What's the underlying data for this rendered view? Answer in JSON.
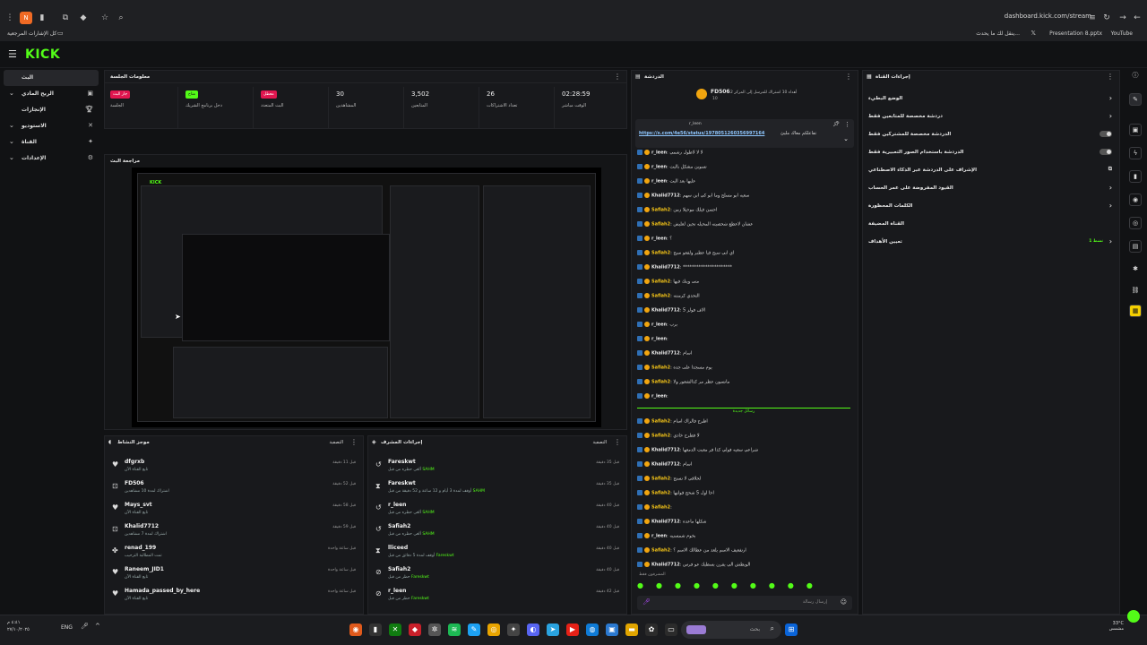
{
  "browser": {
    "url": "dashboard.kick.com/stream",
    "bookmarks_label": "كل الإشارات المرجعية",
    "bookmarks": [
      "ينقل لك ما يحدث...",
      "Presentation 8.pptx",
      "YouTube"
    ]
  },
  "app": {
    "logo": "KICK",
    "nav": [
      {
        "label": "البث",
        "icon": "broadcast-icon",
        "active": true
      },
      {
        "label": "الربح المادي",
        "icon": "money-icon"
      },
      {
        "label": "الإنجازات",
        "icon": "trophy-icon"
      },
      {
        "label": "الاستوديو",
        "icon": "studio-icon"
      },
      {
        "label": "القناة",
        "icon": "channel-icon"
      },
      {
        "label": "الإعدادات",
        "icon": "gear-icon"
      }
    ]
  },
  "session": {
    "title": "معلومات الجلسة",
    "stats": [
      {
        "badge": "جار البث",
        "badge_color": "#e0164f",
        "label": "الجلسة"
      },
      {
        "badge": "متاح",
        "badge_color": "#53fc18",
        "label": "دخل برنامج الشريك"
      },
      {
        "badge": "معطل",
        "badge_color": "#e0164f",
        "label": "البث المتعدد"
      },
      {
        "value": "30",
        "label": "المشاهدين"
      },
      {
        "value": "3,502",
        "label": "المتابعين"
      },
      {
        "value": "26",
        "label": "تعداد الاشتراكات"
      },
      {
        "value": "02:28:59",
        "label": "الوقت مباشر"
      }
    ]
  },
  "preview": {
    "title": "مراجعة البث"
  },
  "activity": {
    "title": "موجز النشاط",
    "filter_label": "التصفية",
    "items": [
      {
        "name": "dfgrxb",
        "sub": "تابع القناة الآن",
        "time": "قبل 11 دقيقة",
        "icon": "heart-icon"
      },
      {
        "name": "FD506",
        "sub": "اشتراك لمدة 10 مشاهدين",
        "time": "قبل 52 دقيقة",
        "icon": "gift-icon"
      },
      {
        "name": "Mays_svt",
        "sub": "تابع القناة الآن",
        "time": "قبل 58 دقيقة",
        "icon": "heart-icon"
      },
      {
        "name": "Khalid7712",
        "sub": "اشتراك لمدة 7 مشاهدين",
        "time": "قبل 59 دقيقة",
        "icon": "gift-icon"
      },
      {
        "name": "renad_199",
        "sub": "تمت المطالبة الترحيب",
        "time": "قبل ساعة واحدة",
        "icon": "reward-icon"
      },
      {
        "name": "Raneem_JID1",
        "sub": "تابع القناة الآن",
        "time": "قبل ساعة واحدة",
        "icon": "heart-icon"
      },
      {
        "name": "Hamada_passed_by_here",
        "sub": "تابع القناة الآن",
        "time": "قبل ساعة واحدة",
        "icon": "heart-icon"
      }
    ]
  },
  "modlog": {
    "title": "إجراءات المشرف",
    "filter_label": "التصفية",
    "items": [
      {
        "name": "Fareskwt",
        "sub": "ألغى حظره من قبل",
        "by": "SAHM",
        "time": "قبل 35 دقيقة",
        "icon": "undo-icon"
      },
      {
        "name": "Fareskwt",
        "sub": "أوقف لمدة 3 أيام و 12 ساعة و 52 دقيقة من قبل",
        "by": "SAHM",
        "time": "قبل 35 دقيقة",
        "icon": "hourglass-icon"
      },
      {
        "name": "r_leen",
        "sub": "ألغى حظره من قبل",
        "by": "SAHM",
        "time": "قبل 40 دقيقة",
        "icon": "undo-icon"
      },
      {
        "name": "Safiah2",
        "sub": "ألغى حظره من قبل",
        "by": "SAHM",
        "time": "قبل 40 دقيقة",
        "icon": "undo-icon"
      },
      {
        "name": "lliceed",
        "sub": "أوقف لمدة 5 دقائق من قبل",
        "by": "Fareskwt",
        "time": "قبل 40 دقيقة",
        "icon": "hourglass-icon"
      },
      {
        "name": "Safiah2",
        "sub": "حظر من قبل",
        "by": "Fareskwt",
        "time": "قبل 40 دقيقة",
        "icon": "ban-icon"
      },
      {
        "name": "r_leen",
        "sub": "حظر من قبل",
        "by": "Fareskwt",
        "time": "قبل 42 دقيقة",
        "icon": "ban-icon"
      }
    ]
  },
  "chat": {
    "title": "الدردشة",
    "pinned_user": "FD506",
    "pinned_sub": "أهداء 10 اشتراك للمرسل إلى المركز 2",
    "pinned_count": "10",
    "pinned_by": "r_leen",
    "pinned_link": "https://x.com/4e56/status/1978051260356997164",
    "pinned_text": "تفاعلكم معاك مليئ",
    "new_messages": "رسائل جديدة",
    "moderators_label": "المشرفون فقط",
    "input_placeholder": "إرسال رسالة",
    "messages": [
      {
        "user": "r_leen",
        "text": "لا لا لاطول رشمي",
        "yellow": false
      },
      {
        "user": "r_leen",
        "text": "تسوين مشكل بالبث",
        "yellow": false
      },
      {
        "user": "r_leen",
        "text": "عليها بعد البث",
        "yellow": false
      },
      {
        "user": "Khalid7712",
        "text": "سعيه ابو مسلح وما ابو كي ابن سهم",
        "yellow": false
      },
      {
        "user": "Safiah2",
        "text": "احسن قيلك موحيلا زمن",
        "yellow": true
      },
      {
        "user": "Safiah2",
        "text": "عشان لاعطع شحصيته المحيله تجين لعليش",
        "yellow": true
      },
      {
        "user": "r_leen",
        "text": "؟",
        "yellow": false
      },
      {
        "user": "Safiah2",
        "text": "اي ابي سيح قيا عطبر ولفعو سيح",
        "yellow": true
      },
      {
        "user": "Khalid7712",
        "text": "**********************",
        "yellow": false
      },
      {
        "user": "Safiah2",
        "text": "متى وينك فيها",
        "yellow": true
      },
      {
        "user": "Safiah2",
        "text": "التحدي كرمنته",
        "yellow": true
      },
      {
        "user": "Khalid7712",
        "text": "الاف فولز 5",
        "yellow": false
      },
      {
        "user": "r_leen",
        "text": "برب",
        "yellow": false
      },
      {
        "user": "r_leen",
        "text": "",
        "yellow": false
      },
      {
        "user": "Khalid7712",
        "text": "اسام",
        "yellow": false
      },
      {
        "user": "Safiah2",
        "text": "يوم مسجدا على جده",
        "yellow": true
      },
      {
        "user": "Safiah2",
        "text": "مانسون عطر مر كذالشعور ولا",
        "yellow": true
      },
      {
        "user": "r_leen",
        "text": "",
        "yellow": false
      },
      {
        "user": "Safiah2",
        "text": "اطرح فالراك اسام",
        "yellow": true
      },
      {
        "user": "Safiah2",
        "text": "لا فطرح خادي",
        "yellow": true
      },
      {
        "user": "Khalid7712",
        "text": "شراعي سعيه فولي كذا فر معبت الدمعها",
        "yellow": false
      },
      {
        "user": "Khalid7712",
        "text": "اسام",
        "yellow": false
      },
      {
        "user": "Safiah2",
        "text": "لحلاقي لا تستح",
        "yellow": true
      },
      {
        "user": "Safiah2",
        "text": "اخا اول 5 شحح قولتها",
        "yellow": true
      },
      {
        "user": "Safiah2",
        "text": "",
        "yellow": true
      },
      {
        "user": "Khalid7712",
        "text": "شكلها ماعده",
        "yellow": false
      },
      {
        "user": "r_leen",
        "text": "بخوم شمسنيه",
        "yellow": false
      },
      {
        "user": "Safiah2",
        "text": "ارتفعيف الاسم يلعد من عطالك الاسم ؟",
        "yellow": true
      },
      {
        "user": "Khalid7712",
        "text": "الويطش الي يفرن بسطيك عو فرس",
        "yellow": false
      }
    ]
  },
  "settings": {
    "title": "إجراءات القناة",
    "rows": [
      {
        "label": "الوضع البطيء",
        "control": "chevron"
      },
      {
        "label": "دردشة مخصصة للمتابعين فقط",
        "control": "chevron"
      },
      {
        "label": "الدردشة مخصصة للمشتركين فقط",
        "control": "toggle"
      },
      {
        "label": "الدردشة باستخدام الصور التعبيرية فقط",
        "control": "toggle"
      },
      {
        "label": "الإشراف على الدردشة عبر الذكاء الاصطناعي",
        "control": "external"
      },
      {
        "label": "القيود المفروضة على عمر الحساب",
        "control": "chevron"
      },
      {
        "label": "الكلمات المحظورة",
        "control": "chevron"
      },
      {
        "label": "القناة المضيفة",
        "control": "none"
      },
      {
        "label": "تعيين الأهداف",
        "control": "chevron",
        "extra": "1 نشط"
      }
    ]
  },
  "taskbar": {
    "time": "٤:٤١ م",
    "date": "٢٧/١٠/٢٠٢٥",
    "lang": "ENG",
    "search_placeholder": "بحث",
    "weather": "33°C",
    "weather_label": "مشمس"
  }
}
